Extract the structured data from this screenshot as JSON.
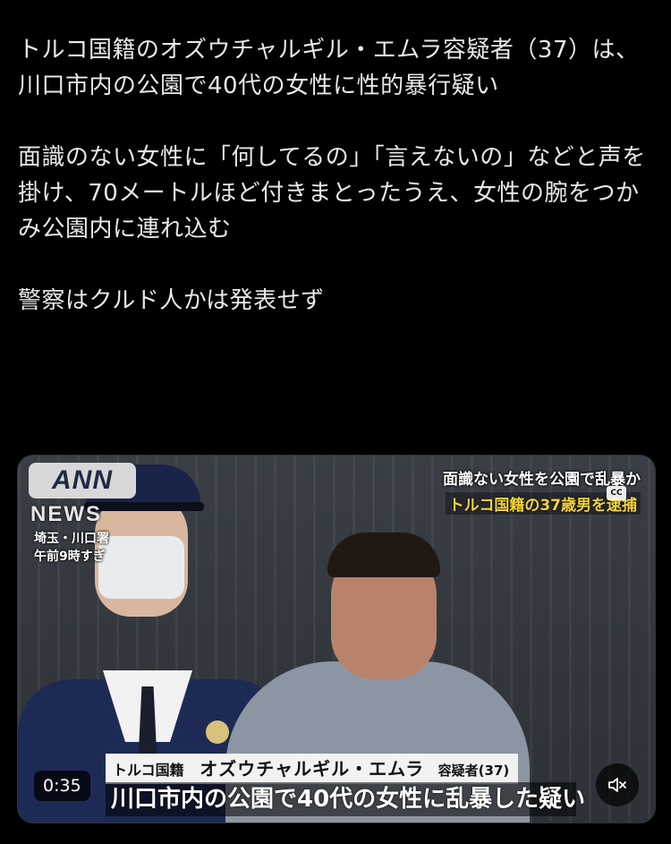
{
  "post": {
    "paragraph1": "トルコ国籍のオズウチャルギル・エムラ容疑者（37）は、川口市内の公園で40代の女性に性的暴行疑い",
    "paragraph2": "面識のない女性に「何してるの」「言えないの」などと声を掛け、70メートルほど付きまとったうえ、女性の腕をつかみ公園内に連れ込む",
    "paragraph3": "警察はクルド人かは発表せず"
  },
  "video": {
    "logo": "ANN",
    "news_label": "NEWS",
    "location": "埼玉・川口署",
    "time_of_day": "午前9時すぎ",
    "headline_line1": "面識ない女性を公園で乱暴か",
    "headline_line2": "トルコ国籍の37歳男を逮捕",
    "cc_label": "CC",
    "name_bar_label": "トルコ国籍",
    "name_bar_name": "オズウチャルギル・エムラ",
    "name_bar_title": "容疑者(37)",
    "caption": "川口市内の公園で40代の女性に乱暴した疑い",
    "elapsed": "0:35",
    "mute_icon": "speaker-muted-icon"
  }
}
